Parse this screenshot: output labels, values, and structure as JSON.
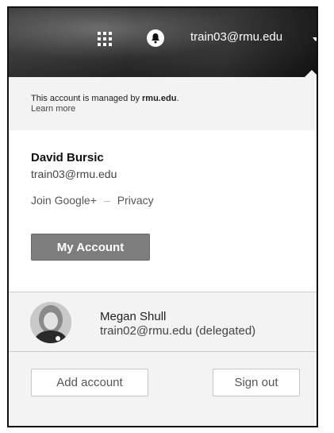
{
  "header": {
    "account_email": "train03@rmu.edu"
  },
  "managed": {
    "prefix": "This account is managed by ",
    "domain": "rmu.edu",
    "suffix": ".",
    "learn_more": "Learn more"
  },
  "profile": {
    "name": "David Bursic",
    "email": "train03@rmu.edu",
    "join_google_plus": "Join Google+",
    "separator": "–",
    "privacy": "Privacy",
    "my_account_button": "My Account"
  },
  "delegated_account": {
    "name": "Megan Shull",
    "email": "train02@rmu.edu (delegated)"
  },
  "footer": {
    "add_account": "Add account",
    "sign_out": "Sign out"
  }
}
